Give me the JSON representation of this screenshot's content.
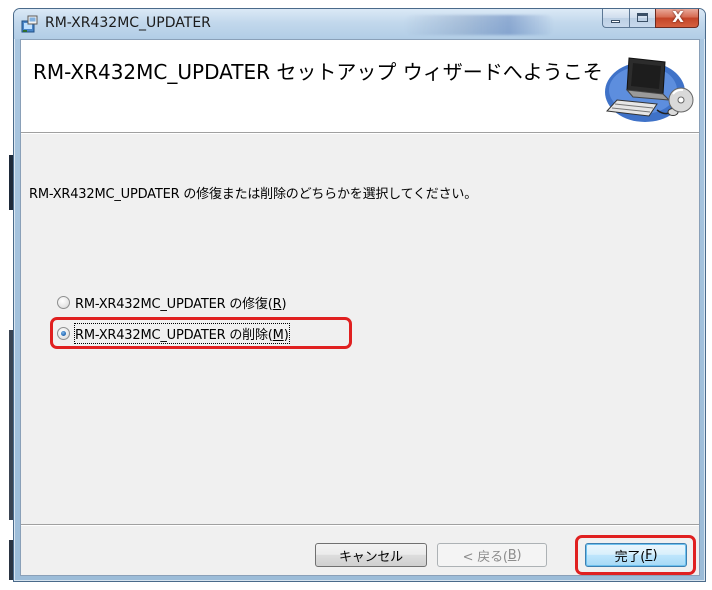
{
  "window": {
    "title": "RM-XR432MC_UPDATER",
    "app_icon": "installer-icon",
    "caption_buttons": {
      "minimize_icon": "minimize-icon",
      "maximize_icon": "maximize-icon",
      "close_glyph": "X"
    }
  },
  "banner": {
    "title": "RM-XR432MC_UPDATER セットアップ ウィザードへようこそ",
    "graphic_icon": "computer-setup-icon"
  },
  "body": {
    "instruction": "RM-XR432MC_UPDATER の修復または削除のどちらかを選択してください。",
    "options": [
      {
        "label_prefix": "RM-XR432MC_UPDATER の修復(",
        "mnemonic": "R",
        "label_suffix": ")",
        "selected": false
      },
      {
        "label_prefix": "RM-XR432MC_UPDATER の削除(",
        "mnemonic": "M",
        "label_suffix": ")",
        "selected": true
      }
    ]
  },
  "buttons": {
    "cancel": {
      "label": "キャンセル"
    },
    "back": {
      "prefix": "< 戻る(",
      "mnemonic": "B",
      "suffix": ")",
      "enabled": false
    },
    "finish": {
      "prefix": "完了(",
      "mnemonic": "F",
      "suffix": ")"
    }
  },
  "colors": {
    "highlight_annotation": "#e02020",
    "selected_radio": "#2a6fb8",
    "titlebar": "#c2d8ec",
    "dialog_background": "#f0f0f0"
  }
}
